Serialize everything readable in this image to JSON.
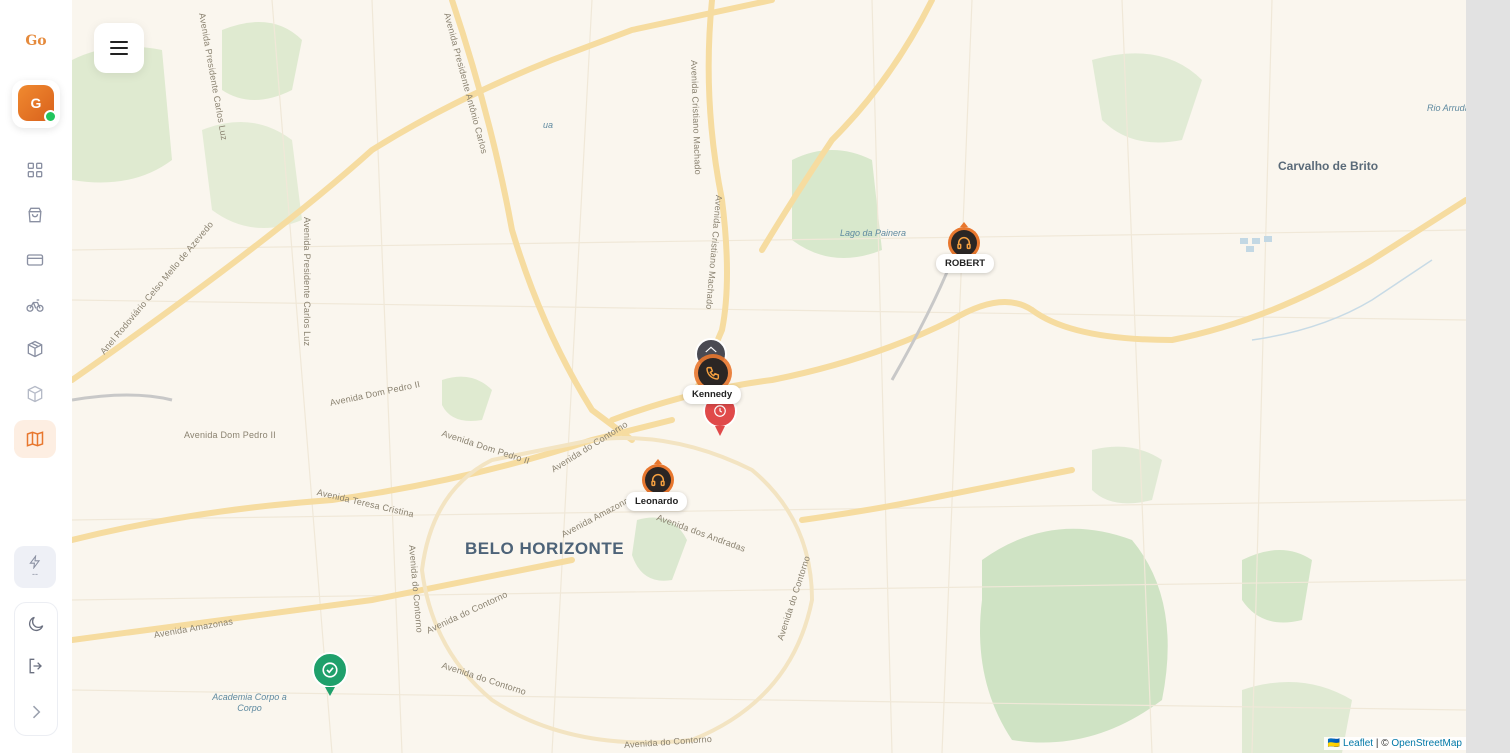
{
  "app": {
    "logo_text": "Go"
  },
  "user": {
    "avatar_initial": "G",
    "status": "online"
  },
  "sidebar": {
    "items": [
      {
        "icon": "dashboard-icon",
        "active": false
      },
      {
        "icon": "shopping-bag-icon",
        "active": false
      },
      {
        "icon": "credit-card-icon",
        "active": false
      },
      {
        "icon": "bicycle-icon",
        "active": false
      },
      {
        "icon": "packages-icon",
        "active": false
      },
      {
        "icon": "box-icon",
        "active": false
      },
      {
        "icon": "map-icon",
        "active": true
      }
    ],
    "bolt_value": "--",
    "bottom_items": [
      {
        "icon": "moon-icon"
      },
      {
        "icon": "logout-icon"
      },
      {
        "icon": "chevron-right-icon"
      }
    ]
  },
  "colors": {
    "accent": "#E8772E",
    "marker_dark": "#2B2624",
    "marker_red": "#E04A4A",
    "marker_green": "#1FA06B",
    "map_background": "#FAF6EE"
  },
  "map": {
    "city_label": "BELO HORIZONTE",
    "town_label": "Carvalho de Brito",
    "places": [
      "Lago da Painera",
      "Academia Corpo a Corpo",
      "Rio Arrudas",
      "ua"
    ],
    "streets": [
      "Avenida Presidente Carlos Luz",
      "Avenida Presidente Antônio Carlos",
      "Avenida Cristiano Machado",
      "Avenida Cristiano Machado",
      "Anel Rodoviário Celso Mello de Azevedo",
      "Avenida Presidente Carlos Luz",
      "Avenida Dom Pedro II",
      "Avenida Dom Pedro II",
      "Avenida Dom Pedro II",
      "Avenida do Contorno",
      "Avenida Teresa Cristina",
      "Avenida Amazonas",
      "Avenida Amazonas",
      "Avenida do Contorno",
      "Avenida do Contorno",
      "Avenida do Contorno",
      "Avenida dos Andradas",
      "Avenida do Contorno",
      "Avenida do Contorno"
    ],
    "markers": [
      {
        "label": "ROBERT",
        "type": "courier",
        "icon": "headphones-icon"
      },
      {
        "label": "Kennedy",
        "type": "courier",
        "icon": "phone-icon"
      },
      {
        "label": "Leonardo",
        "type": "courier",
        "icon": "headphones-icon"
      },
      {
        "label": "",
        "type": "home",
        "icon": "home-icon"
      },
      {
        "label": "",
        "type": "pending",
        "icon": "clock-icon"
      },
      {
        "label": "",
        "type": "delivered",
        "icon": "check-icon"
      }
    ],
    "attribution": {
      "flag": "🇺🇦",
      "leaflet": "Leaflet",
      "separator": " | © ",
      "osm": "OpenStreetMap"
    }
  }
}
